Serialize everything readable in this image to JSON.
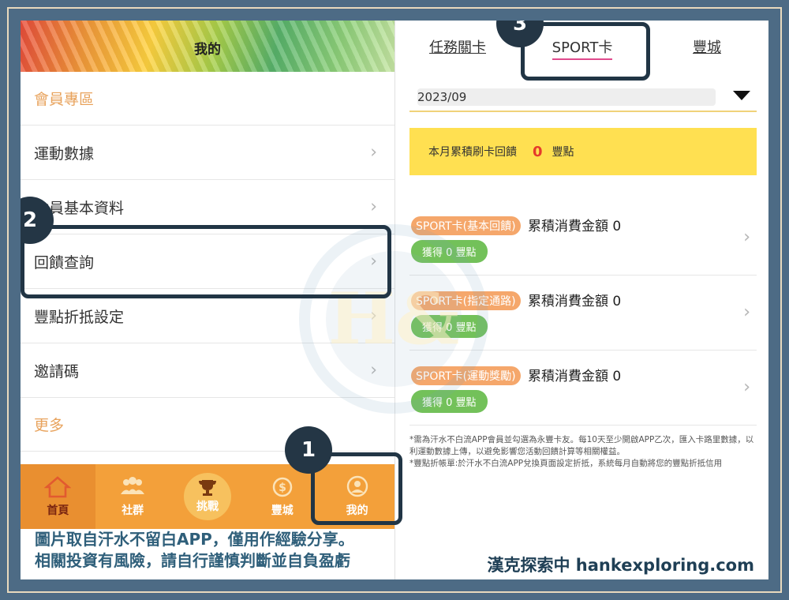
{
  "left": {
    "header_title": "我的",
    "menu": [
      {
        "label": "會員專區",
        "type": "section"
      },
      {
        "label": "運動數據",
        "chevron": "›"
      },
      {
        "label": "會員基本資料",
        "chevron": "›"
      },
      {
        "label": "回饋查詢",
        "chevron": "›"
      },
      {
        "label": "豐點折抵設定",
        "chevron": "›"
      },
      {
        "label": "邀請碼",
        "chevron": "›"
      },
      {
        "label": "更多",
        "type": "section"
      }
    ],
    "tabs": [
      {
        "label": "首頁",
        "icon": "home-icon"
      },
      {
        "label": "社群",
        "icon": "people-icon"
      },
      {
        "label": "挑戰",
        "icon": "trophy-icon"
      },
      {
        "label": "豐城",
        "icon": "coin-icon"
      },
      {
        "label": "我的",
        "icon": "person-icon"
      }
    ]
  },
  "right": {
    "tabs": [
      "任務關卡",
      "SPORT卡",
      "豐城"
    ],
    "date_value": "2023/09",
    "summary": {
      "label": "本月累積刷卡回饋",
      "points": "0",
      "unit": "豐點"
    },
    "items": [
      {
        "badge": "SPORT卡(基本回饋)",
        "text": "累積消費金額 0",
        "earned": "獲得 0 豐點",
        "chevron": "›"
      },
      {
        "badge": "SPORT卡(指定通路)",
        "text": "累積消費金額 0",
        "earned": "獲得 0 豐點",
        "chevron": "›"
      },
      {
        "badge": "SPORT卡(運動獎勵)",
        "text": "累積消費金額 0",
        "earned": "獲得 0 豐點",
        "chevron": "›"
      }
    ],
    "notes": [
      "*需為汗水不白流APP會員並勾選為永豐卡友。每10天至少開啟APP乙次，匯入卡路里數據，以利運動數據上傳，以避免影響您活動回饋計算等相關權益。",
      "*豐點折帳單:於汗水不白流APP兌換頁面設定折抵，系統每月自動將您的豐點折抵信用"
    ]
  },
  "watermark": "H&",
  "callouts": [
    "1",
    "2",
    "3"
  ],
  "caption": {
    "line1": "圖片取自汗水不留白APP，僅用作經驗分享。",
    "line2": "相關投資有風險，請自行謹慎判斷並自負盈虧",
    "brand": "漢克探索中 hankexploring.com"
  }
}
